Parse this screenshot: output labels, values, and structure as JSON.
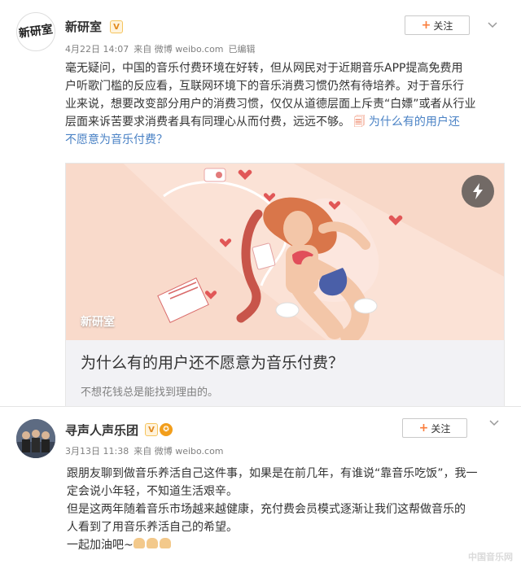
{
  "post1": {
    "author": "新研室",
    "avatar_text": "新研室",
    "vip_badge": "V",
    "date": "4月22日 14:07",
    "via": "来自 微博 weibo.com",
    "edited": "已编辑",
    "follow_label": "关注",
    "body_lines": [
      "毫无疑问，中国的音乐付费环境在好转，但从网民对于近期音乐APP提高免费用",
      "户听歌门槛的反应看，互联网环境下的音乐消费习惯仍然有待培养。对于音乐行",
      "业来说，想要改变部分用户的消费习惯，仅仅从道德层面上斥责“白嫖”或者从行业",
      "层面来诉苦要求消费者具有同理心从而付费，远远不够。"
    ],
    "link_tail": "为什么有的用户还",
    "link_tail2": "不愿意为音乐付费？",
    "card": {
      "source_label": "新研室",
      "title": "为什么有的用户还不愿意为音乐付费？",
      "desc": "不想花钱总是能找到理由的。"
    }
  },
  "post2": {
    "author": "寻声人声乐团",
    "vip_badge": "V",
    "gold_badge": "✪",
    "date": "3月13日 11:38",
    "via": "来自 微博 weibo.com",
    "follow_label": "关注",
    "body_lines": [
      "跟朋友聊到做音乐养活自己这件事，如果是在前几年，有谁说“靠音乐吃饭”，我一",
      "定会说小年轻，不知道生活艰辛。",
      "但是这两年随着音乐市场越来越健康，充付费会员模式逐渐让我们这帮做音乐的",
      "人看到了用音乐养活自己的希望。",
      "一起加油吧~"
    ]
  },
  "watermark": "中国音乐网",
  "colors": {
    "accent": "#fa7d3c",
    "link": "#eb7350",
    "meta": "#808080"
  }
}
